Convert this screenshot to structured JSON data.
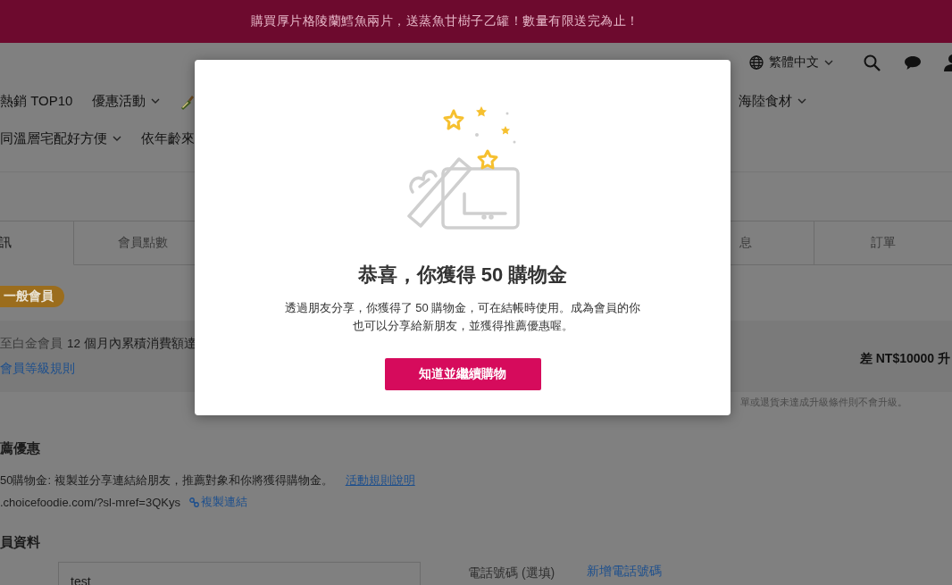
{
  "announcement_bar": {
    "text": "購買厚片格陵蘭鱈魚兩片，送蒸魚甘樹子乙罐！數量有限送完為止！"
  },
  "header": {
    "language": "繁體中文"
  },
  "nav": {
    "row_1": [
      {
        "label": "熱銷 TOP10",
        "dropdown": false
      },
      {
        "label": "優惠活動",
        "dropdown": true
      }
    ],
    "row_1_right": [
      {
        "label": "海陸食材",
        "dropdown": true
      }
    ],
    "row_2": [
      {
        "label": "同溫層宅配好方便",
        "dropdown": true
      },
      {
        "label": "依年齡來",
        "dropdown": false
      }
    ]
  },
  "tabs": [
    {
      "label": "訊",
      "selected": true
    },
    {
      "label": "會員點數",
      "selected": false
    },
    {
      "label": "息",
      "selected": false
    },
    {
      "label": "訂單",
      "selected": false
    }
  ],
  "member_level": {
    "badge": "一般會員",
    "next_level": "至白金會員",
    "condition": "12 個月內累積消費額達",
    "rules_link": "會員等級規則",
    "remaining": "差 NT$10000 升",
    "note": "單或退貨未達成升級條件則不會升級。"
  },
  "referral": {
    "heading": "薦優惠",
    "description": "50購物金: 複製並分享連結給朋友，推薦對象和你將獲得購物金。",
    "rules_link": "活動規則說明",
    "url": ".choicefoodie.com/?sl-mref=3QKys",
    "copy_link": "複製連結"
  },
  "profile": {
    "heading": "員資料",
    "name_value": "test",
    "phone_label": "電話號碼 (選填)",
    "add_phone_link": "新增電話號碼"
  },
  "modal": {
    "title": "恭喜，你獲得 50 購物金",
    "message_lines": [
      "透過朋友分享，你獲得了 50 購物金，可在結帳時使用。成為會員的你",
      "也可以分享給新朋友，並獲得推薦優惠喔。"
    ],
    "button": "知道並繼續購物"
  }
}
